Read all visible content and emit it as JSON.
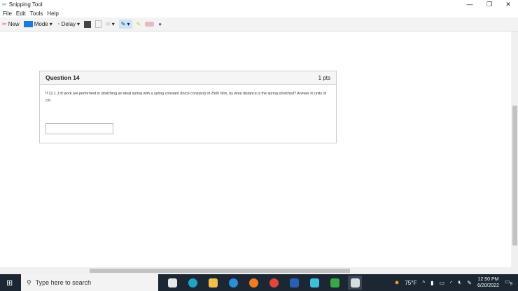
{
  "window": {
    "title": "Snipping Tool",
    "controls": [
      "—",
      "❐",
      "✕"
    ]
  },
  "menu": [
    "File",
    "Edit",
    "Tools",
    "Help"
  ],
  "toolbar": {
    "new": "New",
    "mode": "Mode",
    "delay": "Delay"
  },
  "question": {
    "title": "Question 14",
    "points": "1 pts",
    "text": "If 12.1 J of work are performed in stretching an ideal spring with a spring constant (force constant) of 2500 N/m, by what distance is the spring stretched? Answer in units of cm.",
    "answer": ""
  },
  "taskbar": {
    "search_placeholder": "Type here to search",
    "weather": "75°F",
    "time": "12:50 PM",
    "date": "6/20/2022",
    "notifications": "9"
  }
}
